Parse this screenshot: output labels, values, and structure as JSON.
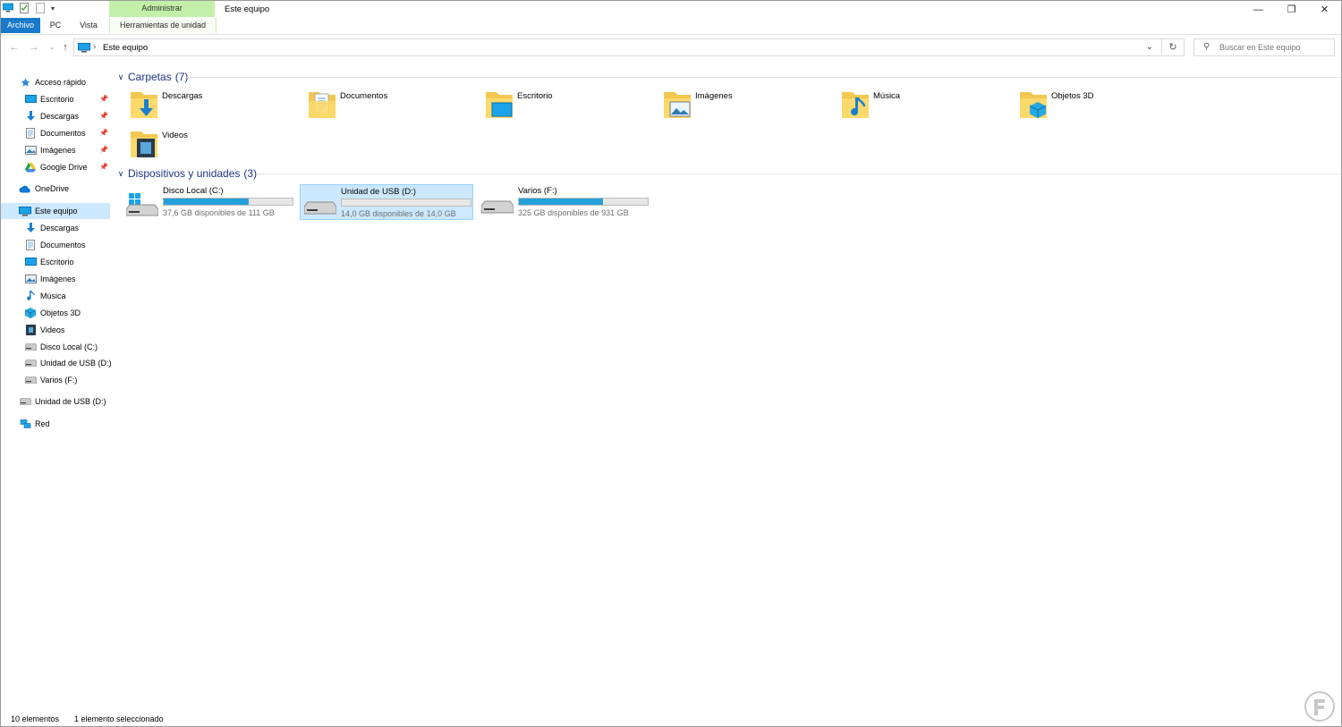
{
  "window": {
    "title": "Este equipo",
    "context_tab_header": "Administrar",
    "controls": {
      "minimize": "—",
      "restore": "❐",
      "close": "✕"
    }
  },
  "ribbon": {
    "tabs": [
      "Archivo",
      "PC",
      "Vista",
      "Herramientas de unidad"
    ]
  },
  "address_bar": {
    "breadcrumb": "Este equipo",
    "search_placeholder": "Buscar en Este equipo"
  },
  "sidebar": {
    "quick_access": {
      "label": "Acceso rápido",
      "items": [
        {
          "label": "Escritorio",
          "icon": "desktop-icon",
          "pinned": true
        },
        {
          "label": "Descargas",
          "icon": "download-icon",
          "pinned": true
        },
        {
          "label": "Documentos",
          "icon": "documents-icon",
          "pinned": true
        },
        {
          "label": "Imágenes",
          "icon": "pictures-icon",
          "pinned": true
        },
        {
          "label": "Google Drive",
          "icon": "google-drive-icon",
          "pinned": true
        }
      ]
    },
    "onedrive": {
      "label": "OneDrive",
      "icon": "cloud-icon"
    },
    "this_pc": {
      "label": "Este equipo",
      "selected": true,
      "items": [
        {
          "label": "Descargas",
          "icon": "download-icon"
        },
        {
          "label": "Documentos",
          "icon": "documents-icon"
        },
        {
          "label": "Escritorio",
          "icon": "desktop-icon"
        },
        {
          "label": "Imágenes",
          "icon": "pictures-icon"
        },
        {
          "label": "Música",
          "icon": "music-icon"
        },
        {
          "label": "Objetos 3D",
          "icon": "3d-objects-icon"
        },
        {
          "label": "Videos",
          "icon": "videos-icon"
        },
        {
          "label": "Disco Local (C:)",
          "icon": "drive-icon"
        },
        {
          "label": "Unidad de USB (D:)",
          "icon": "usb-drive-icon"
        },
        {
          "label": "Varios (F:)",
          "icon": "drive-icon"
        }
      ]
    },
    "usb": {
      "label": "Unidad de USB (D:)",
      "icon": "usb-drive-icon"
    },
    "network": {
      "label": "Red",
      "icon": "network-icon"
    }
  },
  "folders_group": {
    "title": "Carpetas",
    "count": "(7)",
    "items": [
      {
        "label": "Descargas",
        "icon": "download-folder-icon"
      },
      {
        "label": "Documentos",
        "icon": "documents-folder-icon"
      },
      {
        "label": "Escritorio",
        "icon": "desktop-folder-icon"
      },
      {
        "label": "Imágenes",
        "icon": "pictures-folder-icon"
      },
      {
        "label": "Música",
        "icon": "music-folder-icon"
      },
      {
        "label": "Objetos 3D",
        "icon": "3d-objects-folder-icon"
      },
      {
        "label": "Videos",
        "icon": "videos-folder-icon"
      }
    ]
  },
  "drives_group": {
    "title": "Dispositivos y unidades",
    "count": "(3)",
    "items": [
      {
        "name": "Disco Local (C:)",
        "free": "37,6 GB disponibles de 111 GB",
        "used_fraction": 0.66,
        "selected": false,
        "icon": "windows-drive-icon"
      },
      {
        "name": "Unidad de USB (D:)",
        "free": "14,0 GB disponibles de 14,0 GB",
        "used_fraction": 0.0,
        "selected": true,
        "icon": "usb-drive-icon"
      },
      {
        "name": "Varios (F:)",
        "free": "325 GB disponibles de 931 GB",
        "used_fraction": 0.65,
        "selected": false,
        "icon": "drive-icon"
      }
    ]
  },
  "status_bar": {
    "count": "10 elementos",
    "selection": "1 elemento seleccionado"
  },
  "colors": {
    "accent": "#1979ca",
    "selection": "#cce8ff",
    "group_header": "#1e3287",
    "context_tab": "#c3f0a8",
    "drive_bar": "#26a0da"
  }
}
